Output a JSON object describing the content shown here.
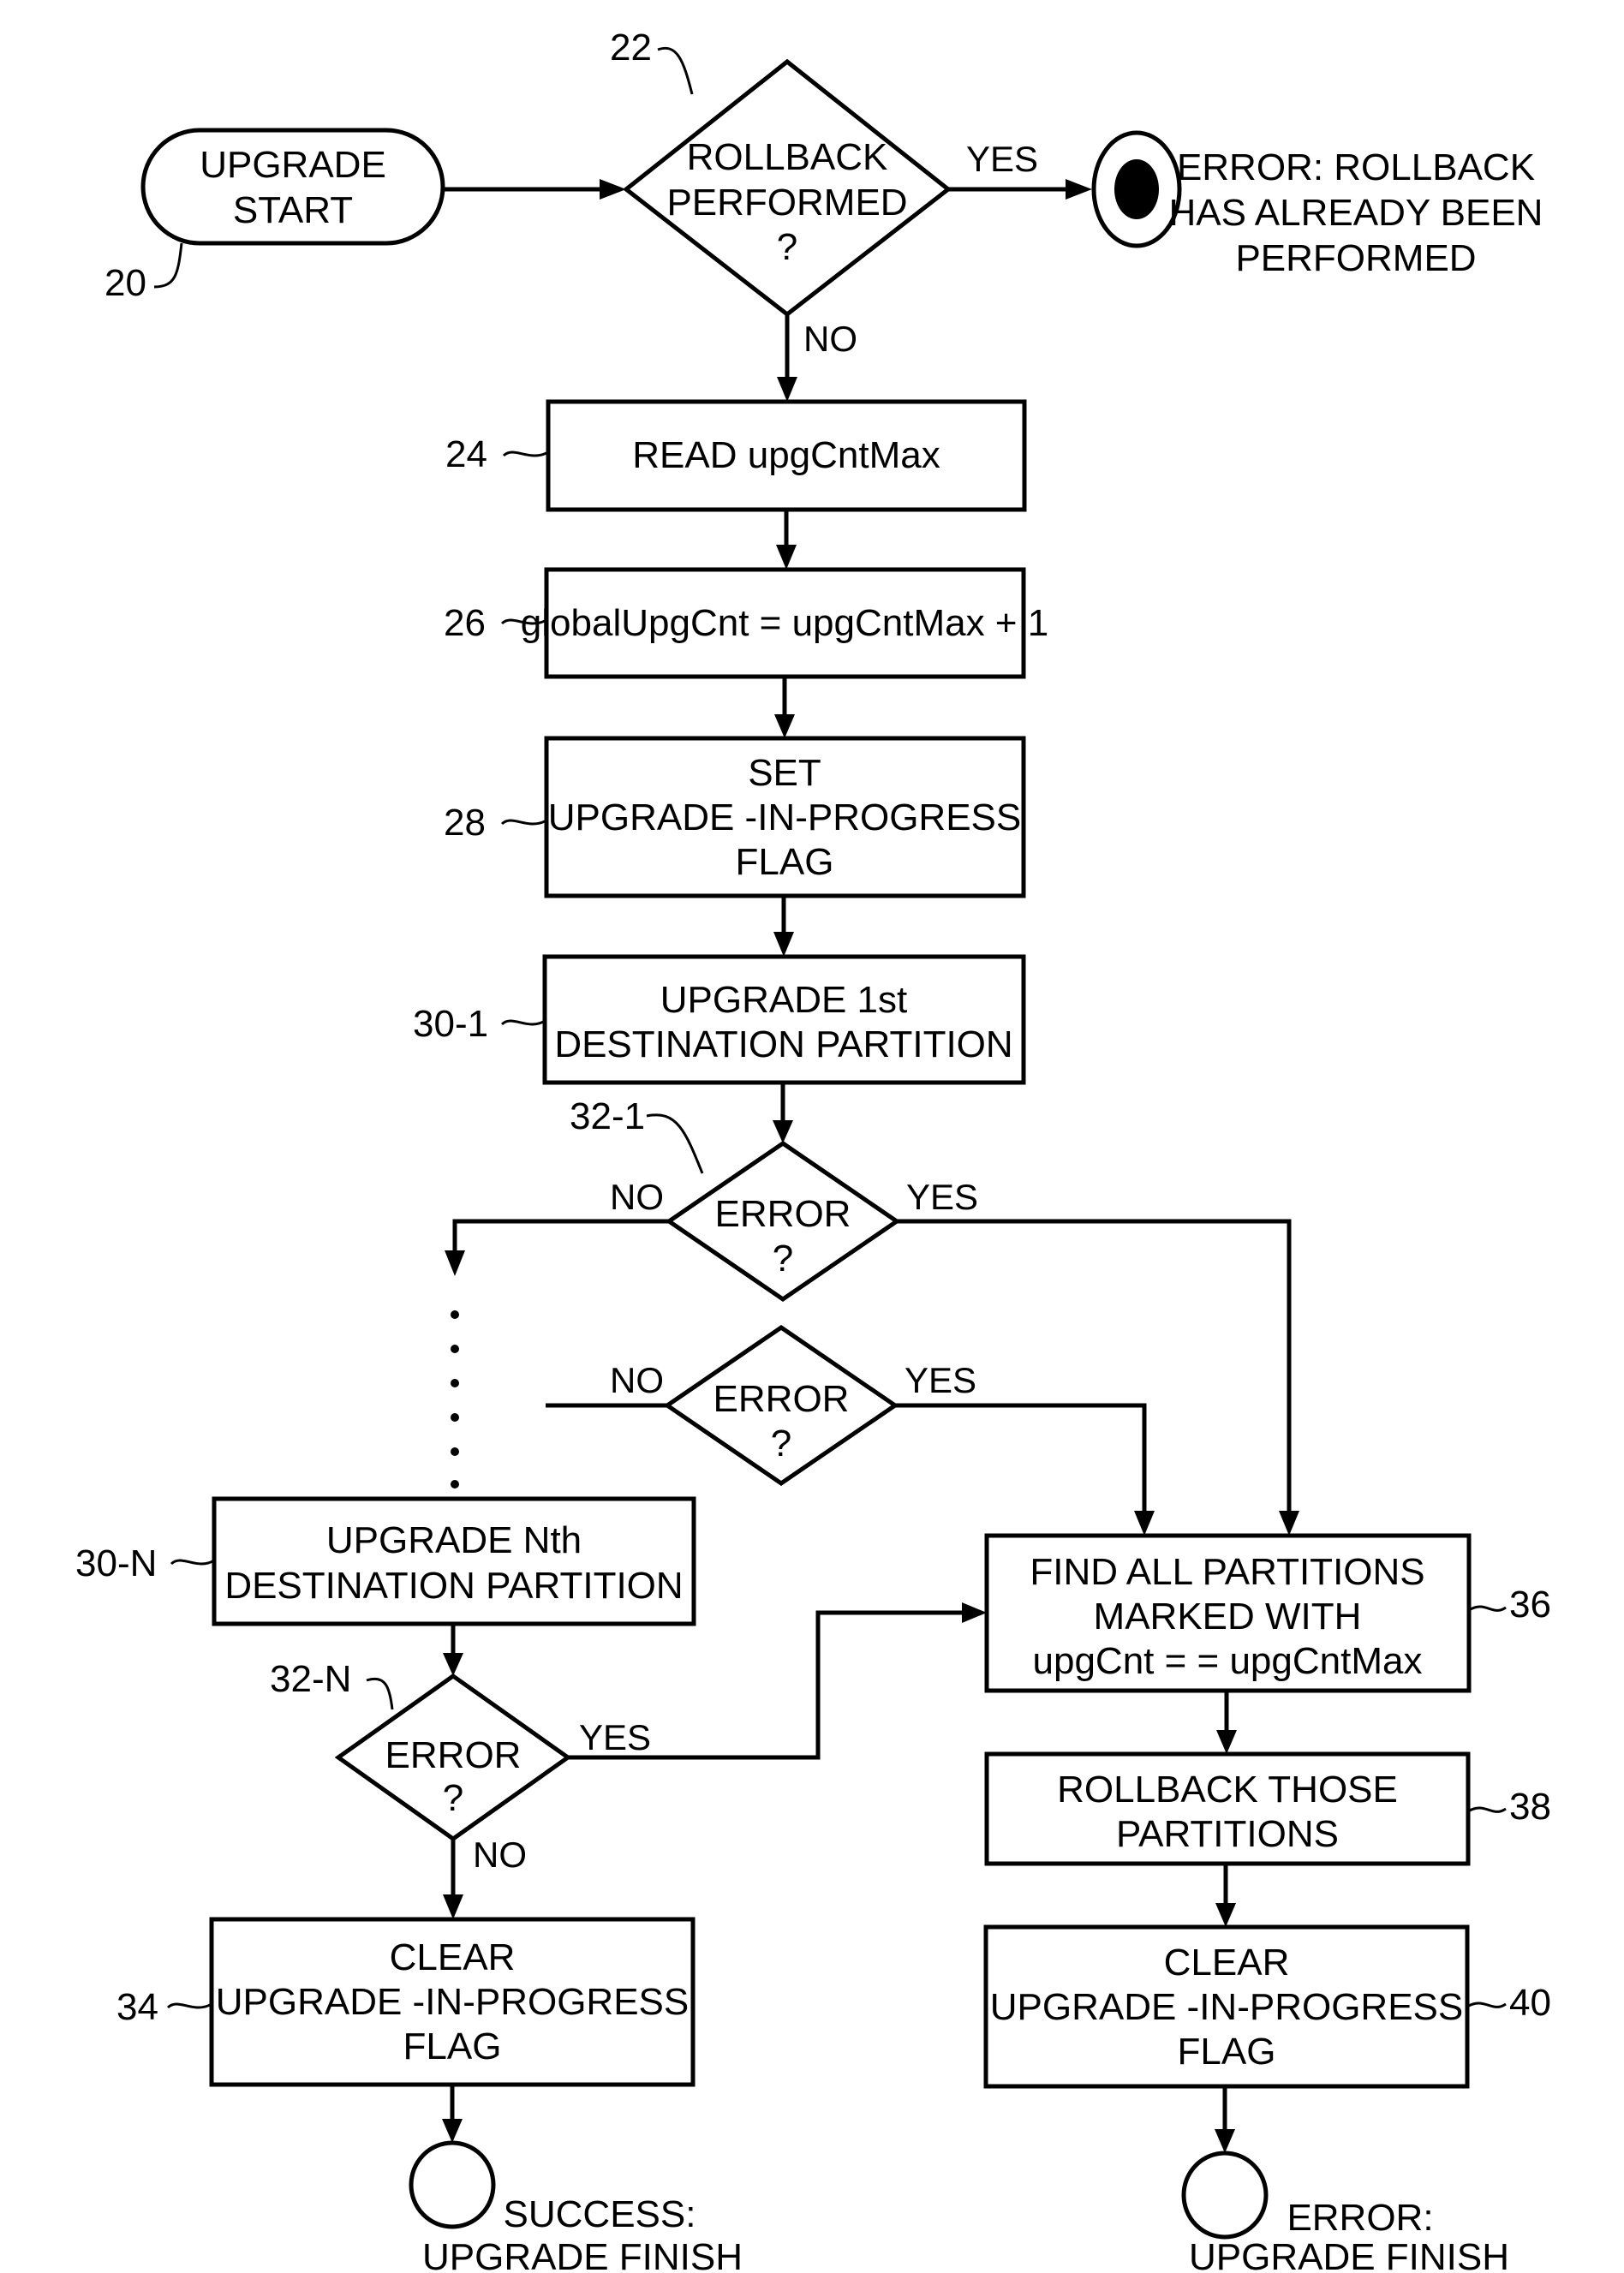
{
  "diagram": {
    "start": {
      "ref": "20",
      "lines": [
        "UPGRADE",
        "START"
      ]
    },
    "decision_rollback": {
      "ref": "22",
      "lines": [
        "ROLLBACK",
        "PERFORMED",
        "?"
      ],
      "yes": "YES",
      "no": "NO"
    },
    "terminal_rollback_error": {
      "lines": [
        "ERROR: ROLLBACK",
        "HAS ALREADY BEEN",
        "PERFORMED"
      ]
    },
    "read_max": {
      "ref": "24",
      "lines": [
        "READ upgCntMax"
      ]
    },
    "set_global": {
      "ref": "26",
      "lines": [
        "globalUpgCnt = upgCntMax + 1"
      ]
    },
    "set_flag": {
      "ref": "28",
      "lines": [
        "SET",
        "UPGRADE -IN-PROGRESS",
        "FLAG"
      ]
    },
    "upgrade_first": {
      "ref": "30-1",
      "lines": [
        "UPGRADE 1st",
        "DESTINATION PARTITION"
      ]
    },
    "error_first": {
      "ref": "32-1",
      "lines": [
        "ERROR",
        "?"
      ],
      "yes": "YES",
      "no": "NO"
    },
    "error_mid": {
      "lines": [
        "ERROR",
        "?"
      ],
      "yes": "YES",
      "no": "NO"
    },
    "upgrade_nth": {
      "ref": "30-N",
      "lines": [
        "UPGRADE Nth",
        "DESTINATION PARTITION"
      ]
    },
    "error_nth": {
      "ref": "32-N",
      "lines": [
        "ERROR",
        "?"
      ],
      "yes": "YES",
      "no": "NO"
    },
    "clear_flag_success": {
      "ref": "34",
      "lines": [
        "CLEAR",
        "UPGRADE -IN-PROGRESS",
        "FLAG"
      ]
    },
    "terminal_success": {
      "lines": [
        "SUCCESS:",
        "UPGRADE FINISH"
      ]
    },
    "find_partitions": {
      "ref": "36",
      "lines": [
        "FIND ALL PARTITIONS",
        "MARKED WITH",
        "upgCnt = = upgCntMax"
      ]
    },
    "rollback_partitions": {
      "ref": "38",
      "lines": [
        "ROLLBACK THOSE",
        "PARTITIONS"
      ]
    },
    "clear_flag_error": {
      "ref": "40",
      "lines": [
        "CLEAR",
        "UPGRADE -IN-PROGRESS",
        "FLAG"
      ]
    },
    "terminal_error": {
      "lines": [
        "ERROR:",
        "UPGRADE FINISH"
      ]
    }
  }
}
